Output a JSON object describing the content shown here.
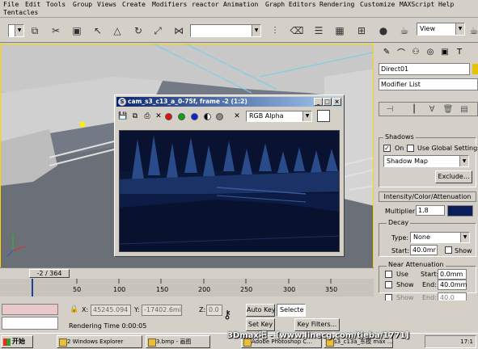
{
  "menu": [
    "File",
    "Edit",
    "Tools",
    "Group",
    "Views",
    "Create",
    "Modifiers",
    "reactor",
    "Animation",
    "Graph Editors",
    "Rendering",
    "Customize",
    "MAXScript",
    "Help",
    "Tentacles"
  ],
  "toolbar": {
    "view_combo": "View"
  },
  "viewport": {
    "label": ""
  },
  "render_window": {
    "title": "cam_s3_c13_a_0-75f, frame -2 (1:2)",
    "channel": "RGB Alpha"
  },
  "panel": {
    "object_name": "Direct01",
    "modifier_list": "Modifier List",
    "shadows": {
      "title": "Shadows",
      "on_label": "On",
      "global_label": "Use Global Settings",
      "type": "Shadow Map",
      "exclude_label": "Exclude..."
    },
    "intensity": {
      "title": "Intensity/Color/Attenuation",
      "multiplier_label": "Multiplier:",
      "multiplier": "1.8",
      "decay_title": "Decay",
      "type_label": "Type:",
      "type": "None",
      "start_label": "Start:",
      "start": "40.0mr",
      "show_label": "Show",
      "near_title": "Near Attenuation",
      "use_label": "Use",
      "near_start_label": "Start:",
      "near_start": "0.0mm",
      "near_show_label": "Show",
      "end_label": "End:",
      "end": "40.0mm",
      "far_show_label": "Show",
      "far_end_label": "End:",
      "far_end": "40.0"
    },
    "light_color": "#0a1f5a"
  },
  "timeline": {
    "frame_indicator": "-2 / 364",
    "ticks": [
      "50",
      "100",
      "150",
      "200",
      "250",
      "300",
      "350"
    ]
  },
  "status": {
    "x": "45245.094",
    "y": "-17402.6mi",
    "z": "0.0",
    "auto_key": "Auto Key",
    "set_key": "Set Key",
    "selected": "Selecte",
    "key_filters": "Key Filters...",
    "rendering_time": "Rendering Time  0:00:05"
  },
  "taskbar": {
    "start": "开始",
    "tasks": [
      "2 Windows Explorer",
      "3.bmp - 画图",
      "Adobe Photoshop C...",
      "s3_c13a_东模 max ..."
    ],
    "watermark": "3Dmax吧 - [www.linecg.com/tieba/1771]",
    "clock": "17:1"
  }
}
